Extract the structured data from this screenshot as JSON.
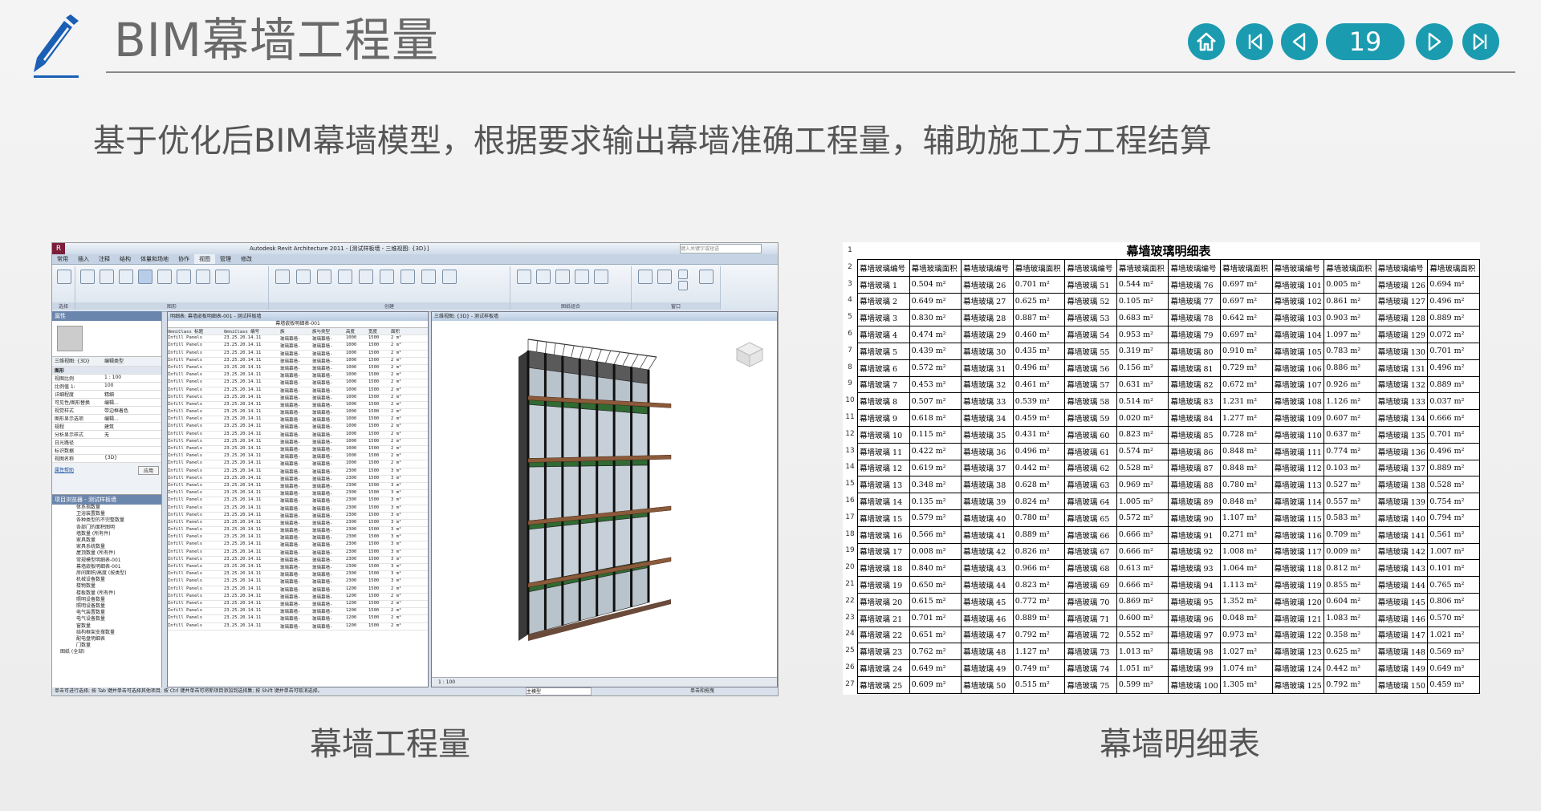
{
  "header": {
    "title": "BIM幕墙工程量",
    "page_number": "19"
  },
  "subtitle": "基于优化后BIM幕墙模型，根据要求输出幕墙准确工程量，辅助施工方工程结算",
  "captions": {
    "left": "幕墙工程量",
    "right": "幕墙明细表"
  },
  "colors": {
    "accent": "#1b9bb0",
    "logo": "#1a5fb4"
  },
  "revit": {
    "app_title": "Autodesk Revit Architecture 2011 - [测试样板墙 - 三维视图: {3D}]",
    "search_placeholder": "键入关键字或短语",
    "tabs": [
      "常用",
      "插入",
      "注释",
      "结构",
      "体量和场地",
      "协作",
      "视图",
      "管理",
      "修改"
    ],
    "active_tab": "视图",
    "ribbon_groups": [
      "选择",
      "图形",
      "创建",
      "图纸组合",
      "窗口"
    ],
    "properties": {
      "header": "属性",
      "view_type": "三维视图: {3D}",
      "edit_type": "编辑类型",
      "section": "图形",
      "rows": [
        [
          "视图比例",
          "1 : 100"
        ],
        [
          "比例值 1:",
          "100"
        ],
        [
          "详细程度",
          "精细"
        ],
        [
          "可见性/图形替换",
          "编辑..."
        ],
        [
          "视觉样式",
          "带边框着色"
        ],
        [
          "图形显示选项",
          "编辑..."
        ],
        [
          "规程",
          "建筑"
        ],
        [
          "分析显示样式",
          "无"
        ],
        [
          "日光路径",
          ""
        ],
        [
          "标识数据",
          ""
        ],
        [
          "视图名称",
          "{3D}"
        ]
      ],
      "help_link": "属性帮助",
      "apply": "应用"
    },
    "browser": {
      "header": "项目浏览器 - 测试样板墙",
      "items": [
        "体系指数量",
        "卫浴装置数量",
        "各种类型的不完整数量",
        "各部门的面积图明",
        "墙数量 (所有件)",
        "家具数量",
        "家具系统数量",
        "屋顶数量 (所有件)",
        "常规模型明细表-001",
        "幕墙嵌板明细表-001",
        "房间面积/高度 (按类型)",
        "机械设备数量",
        "楼物数量",
        "楼板数量 (所有件)",
        "照明设备数量",
        "照明设备数量",
        "电气装置数量",
        "电气设备数量",
        "窗数量",
        "结构框架支撑数量",
        "配电盘明细表",
        "门数量",
        "图纸 (全部)"
      ]
    },
    "schedule": {
      "window_title": "明细表: 幕墙嵌板明细表-001 - 测试样板墙",
      "sheet_title": "幕墙嵌板明细表-001",
      "columns": [
        "OmniClass 标题",
        "OmniClass 编号",
        "族",
        "族与类型",
        "高度",
        "宽度",
        "面积"
      ],
      "rows": [
        [
          "Infill Panels",
          "23.25.20.14.11",
          "玻璃幕墙-",
          "玻璃幕墙-",
          "1000",
          "1500",
          "2 m²"
        ],
        [
          "Infill Panels",
          "23.25.20.14.11",
          "玻璃幕墙-",
          "玻璃幕墙-",
          "1000",
          "1500",
          "2 m²"
        ],
        [
          "Infill Panels",
          "23.25.20.14.11",
          "玻璃幕墙-",
          "玻璃幕墙-",
          "1000",
          "1500",
          "2 m²"
        ],
        [
          "Infill Panels",
          "23.25.20.14.11",
          "玻璃幕墙-",
          "玻璃幕墙-",
          "1000",
          "1500",
          "2 m²"
        ],
        [
          "Infill Panels",
          "23.25.20.14.11",
          "玻璃幕墙-",
          "玻璃幕墙-",
          "1000",
          "1500",
          "2 m²"
        ],
        [
          "Infill Panels",
          "23.25.20.14.11",
          "玻璃幕墙-",
          "玻璃幕墙-",
          "1000",
          "1500",
          "2 m²"
        ],
        [
          "Infill Panels",
          "23.25.20.14.11",
          "玻璃幕墙-",
          "玻璃幕墙-",
          "1000",
          "1500",
          "2 m²"
        ],
        [
          "Infill Panels",
          "23.25.20.14.11",
          "玻璃幕墙-",
          "玻璃幕墙-",
          "1000",
          "1500",
          "2 m²"
        ],
        [
          "Infill Panels",
          "23.25.20.14.11",
          "玻璃幕墙-",
          "玻璃幕墙-",
          "1000",
          "1500",
          "2 m²"
        ],
        [
          "Infill Panels",
          "23.25.20.14.11",
          "玻璃幕墙-",
          "玻璃幕墙-",
          "1000",
          "1500",
          "2 m²"
        ],
        [
          "Infill Panels",
          "23.25.20.14.11",
          "玻璃幕墙-",
          "玻璃幕墙-",
          "1000",
          "1500",
          "2 m²"
        ],
        [
          "Infill Panels",
          "23.25.20.14.11",
          "玻璃幕墙-",
          "玻璃幕墙-",
          "1000",
          "1500",
          "2 m²"
        ],
        [
          "Infill Panels",
          "23.25.20.14.11",
          "玻璃幕墙-",
          "玻璃幕墙-",
          "1000",
          "1500",
          "2 m²"
        ],
        [
          "Infill Panels",
          "23.25.20.14.11",
          "玻璃幕墙-",
          "玻璃幕墙-",
          "1000",
          "1500",
          "2 m²"
        ],
        [
          "Infill Panels",
          "23.25.20.14.11",
          "玻璃幕墙-",
          "玻璃幕墙-",
          "1000",
          "1500",
          "2 m²"
        ],
        [
          "Infill Panels",
          "23.25.20.14.11",
          "玻璃幕墙-",
          "玻璃幕墙-",
          "1000",
          "1500",
          "2 m²"
        ],
        [
          "Infill Panels",
          "23.25.20.14.11",
          "玻璃幕墙-",
          "玻璃幕墙-",
          "1000",
          "1500",
          "2 m²"
        ],
        [
          "Infill Panels",
          "23.25.20.14.11",
          "玻璃幕墙-",
          "玻璃幕墙-",
          "1000",
          "1500",
          "2 m²"
        ],
        [
          "Infill Panels",
          "23.25.20.14.11",
          "玻璃幕墙-",
          "玻璃幕墙-",
          "2300",
          "1500",
          "3 m²"
        ],
        [
          "Infill Panels",
          "23.25.20.14.11",
          "玻璃幕墙-",
          "玻璃幕墙-",
          "2300",
          "1500",
          "3 m²"
        ],
        [
          "Infill Panels",
          "23.25.20.14.11",
          "玻璃幕墙-",
          "玻璃幕墙-",
          "2300",
          "1500",
          "3 m²"
        ],
        [
          "Infill Panels",
          "23.25.20.14.11",
          "玻璃幕墙-",
          "玻璃幕墙-",
          "2300",
          "1500",
          "3 m²"
        ],
        [
          "Infill Panels",
          "23.25.20.14.11",
          "玻璃幕墙-",
          "玻璃幕墙-",
          "2300",
          "1500",
          "3 m²"
        ],
        [
          "Infill Panels",
          "23.25.20.14.11",
          "玻璃幕墙-",
          "玻璃幕墙-",
          "2300",
          "1500",
          "3 m²"
        ],
        [
          "Infill Panels",
          "23.25.20.14.11",
          "玻璃幕墙-",
          "玻璃幕墙-",
          "2300",
          "1500",
          "3 m²"
        ],
        [
          "Infill Panels",
          "23.25.20.14.11",
          "玻璃幕墙-",
          "玻璃幕墙-",
          "2300",
          "1500",
          "3 m²"
        ],
        [
          "Infill Panels",
          "23.25.20.14.11",
          "玻璃幕墙-",
          "玻璃幕墙-",
          "2300",
          "1500",
          "3 m²"
        ],
        [
          "Infill Panels",
          "23.25.20.14.11",
          "玻璃幕墙-",
          "玻璃幕墙-",
          "2300",
          "1500",
          "3 m²"
        ],
        [
          "Infill Panels",
          "23.25.20.14.11",
          "玻璃幕墙-",
          "玻璃幕墙-",
          "2300",
          "1500",
          "3 m²"
        ],
        [
          "Infill Panels",
          "23.25.20.14.11",
          "玻璃幕墙-",
          "玻璃幕墙-",
          "2300",
          "1500",
          "3 m²"
        ],
        [
          "Infill Panels",
          "23.25.20.14.11",
          "玻璃幕墙-",
          "玻璃幕墙-",
          "2300",
          "1500",
          "3 m²"
        ],
        [
          "Infill Panels",
          "23.25.20.14.11",
          "玻璃幕墙-",
          "玻璃幕墙-",
          "2300",
          "1500",
          "3 m²"
        ],
        [
          "Infill Panels",
          "23.25.20.14.11",
          "玻璃幕墙-",
          "玻璃幕墙-",
          "2300",
          "1500",
          "3 m²"
        ],
        [
          "Infill Panels",
          "23.25.20.14.11",
          "玻璃幕墙-",
          "玻璃幕墙-",
          "2300",
          "1500",
          "3 m²"
        ],
        [
          "Infill Panels",
          "23.25.20.14.11",
          "玻璃幕墙-",
          "玻璃幕墙-",
          "1200",
          "1500",
          "2 m²"
        ],
        [
          "Infill Panels",
          "23.25.20.14.11",
          "玻璃幕墙-",
          "玻璃幕墙-",
          "1200",
          "1500",
          "2 m²"
        ],
        [
          "Infill Panels",
          "23.25.20.14.11",
          "玻璃幕墙-",
          "玻璃幕墙-",
          "1200",
          "1500",
          "2 m²"
        ],
        [
          "Infill Panels",
          "23.25.20.14.11",
          "玻璃幕墙-",
          "玻璃幕墙-",
          "1200",
          "1500",
          "2 m²"
        ],
        [
          "Infill Panels",
          "23.25.20.14.11",
          "玻璃幕墙-",
          "玻璃幕墙-",
          "1200",
          "1500",
          "2 m²"
        ],
        [
          "Infill Panels",
          "23.25.20.14.11",
          "玻璃幕墙-",
          "玻璃幕墙-",
          "1200",
          "1500",
          "2 m²"
        ]
      ]
    },
    "view3d": {
      "window_title": "三维视图: {3D} - 测试样板墙",
      "scale": "1 : 100"
    },
    "status_bar": "单击可进行选择; 按 Tab 键并单击可选择其他项目; 按 Ctrl 键并单击可将新项目添加到选择集; 按 Shift 键并单击可取消选择。",
    "main_model": "主模型",
    "press_drag": "单击和拖曳"
  },
  "panel_schedule": {
    "title": "幕墙玻璃明细表",
    "row_numbers": [
      "1",
      "2",
      "3",
      "4",
      "5",
      "6",
      "7",
      "8",
      "9",
      "10",
      "11",
      "12",
      "13",
      "14",
      "15",
      "16",
      "17",
      "18",
      "19",
      "20",
      "21",
      "22",
      "23",
      "24",
      "25",
      "26",
      "27"
    ],
    "headers": [
      "幕墙玻璃编号",
      "幕墙玻璃面积",
      "幕墙玻璃编号",
      "幕墙玻璃面积",
      "幕墙玻璃编号",
      "幕墙玻璃面积",
      "幕墙玻璃编号",
      "幕墙玻璃面积",
      "幕墙玻璃编号",
      "幕墙玻璃面积",
      "幕墙玻璃编号",
      "幕墙玻璃面积"
    ],
    "rows": [
      [
        "幕墙玻璃 1",
        "0.504 m²",
        "幕墙玻璃 26",
        "0.701 m²",
        "幕墙玻璃 51",
        "0.544 m²",
        "幕墙玻璃 76",
        "0.697 m²",
        "幕墙玻璃 101",
        "0.005 m²",
        "幕墙玻璃 126",
        "0.694 m²"
      ],
      [
        "幕墙玻璃 2",
        "0.649 m²",
        "幕墙玻璃 27",
        "0.625 m²",
        "幕墙玻璃 52",
        "0.105 m²",
        "幕墙玻璃 77",
        "0.697 m²",
        "幕墙玻璃 102",
        "0.861 m²",
        "幕墙玻璃 127",
        "0.496 m²"
      ],
      [
        "幕墙玻璃 3",
        "0.830 m²",
        "幕墙玻璃 28",
        "0.887 m²",
        "幕墙玻璃 53",
        "0.683 m²",
        "幕墙玻璃 78",
        "0.642 m²",
        "幕墙玻璃 103",
        "0.903 m²",
        "幕墙玻璃 128",
        "0.889 m²"
      ],
      [
        "幕墙玻璃 4",
        "0.474 m²",
        "幕墙玻璃 29",
        "0.460 m²",
        "幕墙玻璃 54",
        "0.953 m²",
        "幕墙玻璃 79",
        "0.697 m²",
        "幕墙玻璃 104",
        "1.097 m²",
        "幕墙玻璃 129",
        "0.072 m²"
      ],
      [
        "幕墙玻璃 5",
        "0.439 m²",
        "幕墙玻璃 30",
        "0.435 m²",
        "幕墙玻璃 55",
        "0.319 m²",
        "幕墙玻璃 80",
        "0.910 m²",
        "幕墙玻璃 105",
        "0.783 m²",
        "幕墙玻璃 130",
        "0.701 m²"
      ],
      [
        "幕墙玻璃 6",
        "0.572 m²",
        "幕墙玻璃 31",
        "0.496 m²",
        "幕墙玻璃 56",
        "0.156 m²",
        "幕墙玻璃 81",
        "0.729 m²",
        "幕墙玻璃 106",
        "0.886 m²",
        "幕墙玻璃 131",
        "0.496 m²"
      ],
      [
        "幕墙玻璃 7",
        "0.453 m²",
        "幕墙玻璃 32",
        "0.461 m²",
        "幕墙玻璃 57",
        "0.631 m²",
        "幕墙玻璃 82",
        "0.672 m²",
        "幕墙玻璃 107",
        "0.926 m²",
        "幕墙玻璃 132",
        "0.889 m²"
      ],
      [
        "幕墙玻璃 8",
        "0.507 m²",
        "幕墙玻璃 33",
        "0.539 m²",
        "幕墙玻璃 58",
        "0.514 m²",
        "幕墙玻璃 83",
        "1.231 m²",
        "幕墙玻璃 108",
        "1.126 m²",
        "幕墙玻璃 133",
        "0.037 m²"
      ],
      [
        "幕墙玻璃 9",
        "0.618 m²",
        "幕墙玻璃 34",
        "0.459 m²",
        "幕墙玻璃 59",
        "0.020 m²",
        "幕墙玻璃 84",
        "1.277 m²",
        "幕墙玻璃 109",
        "0.607 m²",
        "幕墙玻璃 134",
        "0.666 m²"
      ],
      [
        "幕墙玻璃 10",
        "0.115 m²",
        "幕墙玻璃 35",
        "0.431 m²",
        "幕墙玻璃 60",
        "0.823 m²",
        "幕墙玻璃 85",
        "0.728 m²",
        "幕墙玻璃 110",
        "0.637 m²",
        "幕墙玻璃 135",
        "0.701 m²"
      ],
      [
        "幕墙玻璃 11",
        "0.422 m²",
        "幕墙玻璃 36",
        "0.496 m²",
        "幕墙玻璃 61",
        "0.574 m²",
        "幕墙玻璃 86",
        "0.848 m²",
        "幕墙玻璃 111",
        "0.774 m²",
        "幕墙玻璃 136",
        "0.496 m²"
      ],
      [
        "幕墙玻璃 12",
        "0.619 m²",
        "幕墙玻璃 37",
        "0.442 m²",
        "幕墙玻璃 62",
        "0.528 m²",
        "幕墙玻璃 87",
        "0.848 m²",
        "幕墙玻璃 112",
        "0.103 m²",
        "幕墙玻璃 137",
        "0.889 m²"
      ],
      [
        "幕墙玻璃 13",
        "0.348 m²",
        "幕墙玻璃 38",
        "0.628 m²",
        "幕墙玻璃 63",
        "0.969 m²",
        "幕墙玻璃 88",
        "0.780 m²",
        "幕墙玻璃 113",
        "0.527 m²",
        "幕墙玻璃 138",
        "0.528 m²"
      ],
      [
        "幕墙玻璃 14",
        "0.135 m²",
        "幕墙玻璃 39",
        "0.824 m²",
        "幕墙玻璃 64",
        "1.005 m²",
        "幕墙玻璃 89",
        "0.848 m²",
        "幕墙玻璃 114",
        "0.557 m²",
        "幕墙玻璃 139",
        "0.754 m²"
      ],
      [
        "幕墙玻璃 15",
        "0.579 m²",
        "幕墙玻璃 40",
        "0.780 m²",
        "幕墙玻璃 65",
        "0.572 m²",
        "幕墙玻璃 90",
        "1.107 m²",
        "幕墙玻璃 115",
        "0.583 m²",
        "幕墙玻璃 140",
        "0.794 m²"
      ],
      [
        "幕墙玻璃 16",
        "0.566 m²",
        "幕墙玻璃 41",
        "0.889 m²",
        "幕墙玻璃 66",
        "0.666 m²",
        "幕墙玻璃 91",
        "0.271 m²",
        "幕墙玻璃 116",
        "0.709 m²",
        "幕墙玻璃 141",
        "0.561 m²"
      ],
      [
        "幕墙玻璃 17",
        "0.008 m²",
        "幕墙玻璃 42",
        "0.826 m²",
        "幕墙玻璃 67",
        "0.666 m²",
        "幕墙玻璃 92",
        "1.008 m²",
        "幕墙玻璃 117",
        "0.009 m²",
        "幕墙玻璃 142",
        "1.007 m²"
      ],
      [
        "幕墙玻璃 18",
        "0.840 m²",
        "幕墙玻璃 43",
        "0.966 m²",
        "幕墙玻璃 68",
        "0.613 m²",
        "幕墙玻璃 93",
        "1.064 m²",
        "幕墙玻璃 118",
        "0.812 m²",
        "幕墙玻璃 143",
        "0.101 m²"
      ],
      [
        "幕墙玻璃 19",
        "0.650 m²",
        "幕墙玻璃 44",
        "0.823 m²",
        "幕墙玻璃 69",
        "0.666 m²",
        "幕墙玻璃 94",
        "1.113 m²",
        "幕墙玻璃 119",
        "0.855 m²",
        "幕墙玻璃 144",
        "0.765 m²"
      ],
      [
        "幕墙玻璃 20",
        "0.615 m²",
        "幕墙玻璃 45",
        "0.772 m²",
        "幕墙玻璃 70",
        "0.869 m²",
        "幕墙玻璃 95",
        "1.352 m²",
        "幕墙玻璃 120",
        "0.604 m²",
        "幕墙玻璃 145",
        "0.806 m²"
      ],
      [
        "幕墙玻璃 21",
        "0.701 m²",
        "幕墙玻璃 46",
        "0.889 m²",
        "幕墙玻璃 71",
        "0.600 m²",
        "幕墙玻璃 96",
        "0.048 m²",
        "幕墙玻璃 121",
        "1.083 m²",
        "幕墙玻璃 146",
        "0.570 m²"
      ],
      [
        "幕墙玻璃 22",
        "0.651 m²",
        "幕墙玻璃 47",
        "0.792 m²",
        "幕墙玻璃 72",
        "0.552 m²",
        "幕墙玻璃 97",
        "0.973 m²",
        "幕墙玻璃 122",
        "0.358 m²",
        "幕墙玻璃 147",
        "1.021 m²"
      ],
      [
        "幕墙玻璃 23",
        "0.762 m²",
        "幕墙玻璃 48",
        "1.127 m²",
        "幕墙玻璃 73",
        "1.013 m²",
        "幕墙玻璃 98",
        "1.027 m²",
        "幕墙玻璃 123",
        "0.625 m²",
        "幕墙玻璃 148",
        "0.569 m²"
      ],
      [
        "幕墙玻璃 24",
        "0.649 m²",
        "幕墙玻璃 49",
        "0.749 m²",
        "幕墙玻璃 74",
        "1.051 m²",
        "幕墙玻璃 99",
        "1.074 m²",
        "幕墙玻璃 124",
        "0.442 m²",
        "幕墙玻璃 149",
        "0.649 m²"
      ],
      [
        "幕墙玻璃 25",
        "0.609 m²",
        "幕墙玻璃 50",
        "0.515 m²",
        "幕墙玻璃 75",
        "0.599 m²",
        "幕墙玻璃 100",
        "1.305 m²",
        "幕墙玻璃 125",
        "0.792 m²",
        "幕墙玻璃 150",
        "0.459 m²"
      ]
    ]
  }
}
